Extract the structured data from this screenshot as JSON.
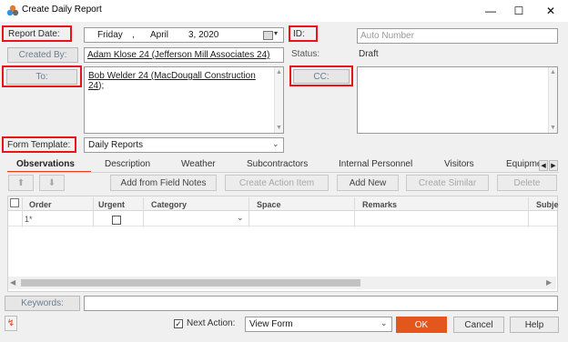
{
  "window": {
    "title": "Create Daily Report",
    "minimize": "—",
    "maximize": "☐",
    "close": "✕"
  },
  "form": {
    "report_date_label": "Report Date:",
    "report_date_value": {
      "day": "Friday",
      "sep": ",",
      "month": "April",
      "date": "3, 2020"
    },
    "id_label": "ID:",
    "id_placeholder": "Auto Number",
    "created_by_label": "Created By:",
    "created_by_value": "Adam Klose 24 (Jefferson Mill Associates 24)",
    "status_label": "Status:",
    "status_value": "Draft",
    "to_label": "To:",
    "to_value_line1": "Bob Welder 24 (MacDougall Construction",
    "to_value_line2_link": "24",
    "to_value_line2_tail": ");",
    "cc_label": "CC:",
    "form_template_label": "Form Template:",
    "form_template_value": "Daily Reports",
    "keywords_label": "Keywords:"
  },
  "tabs": [
    {
      "label": "Observations",
      "active": true
    },
    {
      "label": "Description"
    },
    {
      "label": "Weather"
    },
    {
      "label": "Subcontractors"
    },
    {
      "label": "Internal Personnel"
    },
    {
      "label": "Visitors"
    },
    {
      "label": "Equipme"
    }
  ],
  "toolbar": {
    "move_up": "⬆",
    "move_down": "⬇",
    "add_from_field_notes": "Add from Field Notes",
    "create_action_item": "Create Action Item",
    "add_new": "Add New",
    "create_similar": "Create Similar",
    "delete": "Delete"
  },
  "table": {
    "headers": [
      "Order",
      "Urgent",
      "Category",
      "Space",
      "Remarks",
      "Subje"
    ],
    "rows": [
      {
        "order": "1*",
        "urgent": false,
        "category": "",
        "space": "",
        "remarks": ""
      }
    ]
  },
  "footer": {
    "next_action_label": "Next Action:",
    "next_action_checked": true,
    "next_action_value": "View Form",
    "ok": "OK",
    "cancel": "Cancel",
    "help": "Help"
  },
  "colors": {
    "highlight_red": "#e8141c",
    "accent_orange": "#e0401a",
    "ok_button": "#e3571c"
  }
}
